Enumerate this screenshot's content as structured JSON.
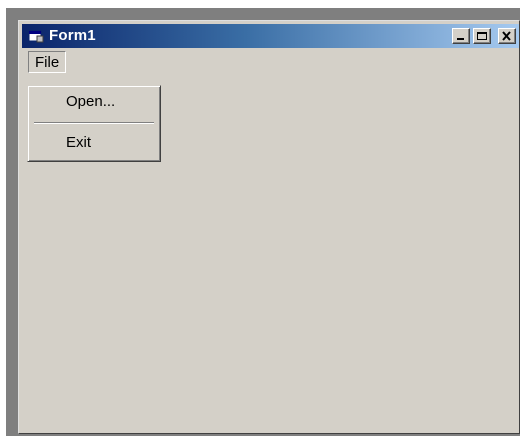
{
  "window": {
    "title": "Form1",
    "titlebar_colors": {
      "start": "#0a246a",
      "end": "#a6caf0"
    },
    "client_color": "#d4d0c8"
  },
  "titlebar_buttons": {
    "minimize": "minimize-icon",
    "maximize": "maximize-icon",
    "close": "close-icon"
  },
  "menubar": {
    "items": [
      {
        "label": "File"
      }
    ]
  },
  "file_menu": {
    "items": [
      {
        "label": "Open..."
      },
      {
        "label": "Exit"
      }
    ]
  }
}
